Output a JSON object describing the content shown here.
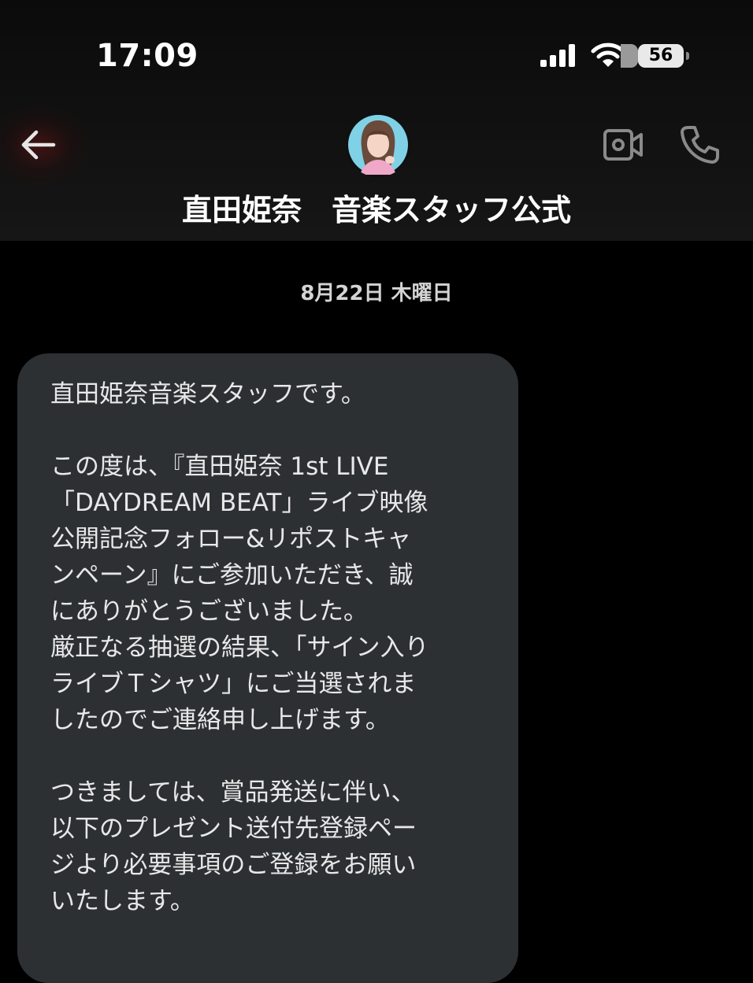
{
  "status_bar": {
    "time": "17:09",
    "battery_level": "56",
    "signal_bars": 4,
    "wifi": "wifi-icon"
  },
  "header": {
    "back_icon": "arrow-left-icon",
    "contact_name": "直田姫奈　音楽スタッフ公式",
    "video_icon": "video-camera-icon",
    "phone_icon": "phone-icon"
  },
  "conversation": {
    "date_separator": "8月22日 木曜日",
    "message_lines": [
      "直田姫奈音楽スタッフです。",
      "",
      "この度は、『直田姫奈 1st LIVE",
      "「DAYDREAM BEAT」ライブ映像",
      "公開記念フォロー&リポストキャ",
      "ンペーン』にご参加いただき、誠",
      "にありがとうございました。",
      "厳正なる抽選の結果、「サイン入り",
      "ライブＴシャツ」にご当選されま",
      "したのでご連絡申し上げます。",
      "",
      "つきましては、賞品発送に伴い、",
      "以下のプレゼント送付先登録ペー",
      "ジより必要事項のご登録をお願い",
      "いたします。"
    ]
  },
  "colors": {
    "background": "#000000",
    "header": "#141414",
    "bubble": "#2d3033",
    "text": "#e8e8e8",
    "icon": "#8a8a8a"
  }
}
